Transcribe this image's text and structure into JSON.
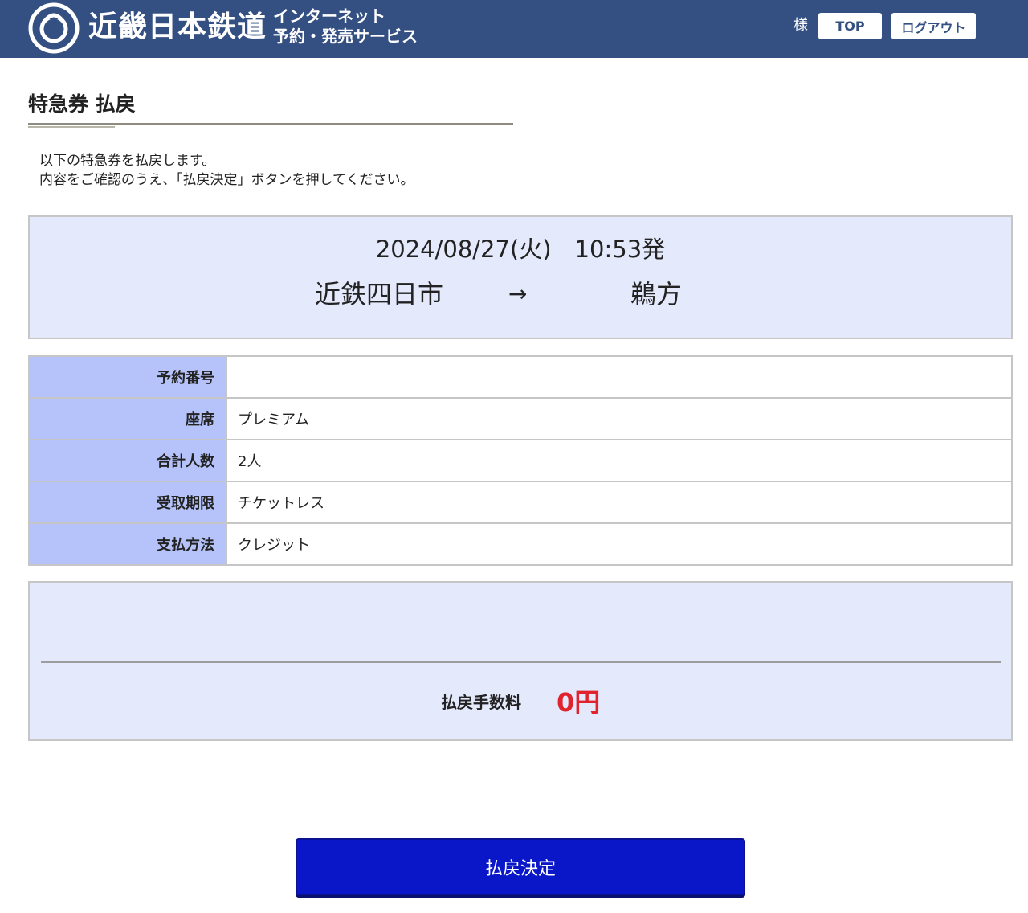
{
  "header": {
    "brand": "近畿日本鉄道",
    "service_line1": "インターネット",
    "service_line2": "予約・発売サービス",
    "user_suffix": "様",
    "top_button": "TOP",
    "logout_button": "ログアウト"
  },
  "page": {
    "title": "特急券 払戻",
    "instruction_line1": "以下の特急券を払戻します。",
    "instruction_line2": "内容をご確認のうえ、「払戻決定」ボタンを押してください。"
  },
  "journey": {
    "datetime": "2024/08/27(火)　10:53発",
    "from": "近鉄四日市",
    "arrow": "→",
    "to": "鵜方"
  },
  "details": [
    {
      "label": "予約番号",
      "value": ""
    },
    {
      "label": "座席",
      "value": "プレミアム"
    },
    {
      "label": "合計人数",
      "value": "2人"
    },
    {
      "label": "受取期限",
      "value": "チケットレス"
    },
    {
      "label": "支払方法",
      "value": "クレジット"
    }
  ],
  "fee": {
    "label": "払戻手数料",
    "value": "0円"
  },
  "actions": {
    "confirm": "払戻決定"
  },
  "colors": {
    "header_bg": "#344f82",
    "panel_bg": "#e4e9fc",
    "label_bg": "#b5c3fa",
    "fee_value": "#e0232d",
    "confirm_bg": "#0a17c9"
  }
}
